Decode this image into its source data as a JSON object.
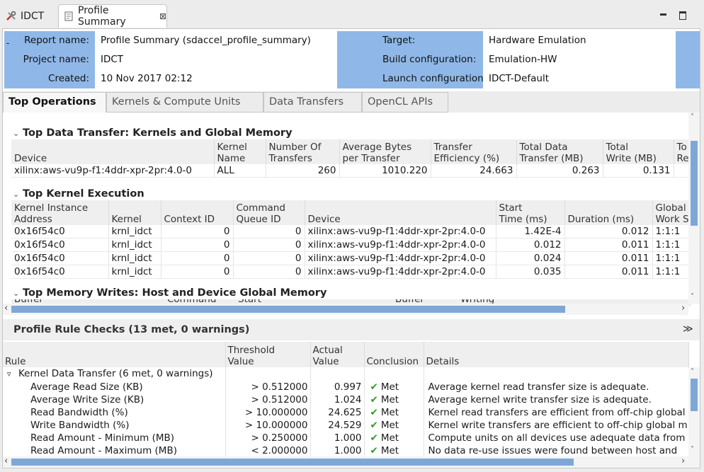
{
  "tabs": {
    "inactive_label": "IDCT",
    "active_label": "Profile Summary",
    "close_glyph": "⊠"
  },
  "header": {
    "report_name_label": "Report name:",
    "report_name": "Profile Summary (sdaccel_profile_summary)",
    "project_name_label": "Project name:",
    "project_name": "IDCT",
    "created_label": "Created:",
    "created": "10 Nov 2017 02:12",
    "target_label": "Target:",
    "target": "Hardware Emulation",
    "build_config_label": "Build configuration:",
    "build_config": "Emulation-HW",
    "launch_config_label": "Launch configuration:",
    "launch_config": "IDCT-Default",
    "collapse_glyph": "-"
  },
  "report_tabs": [
    "Top Operations",
    "Kernels & Compute Units",
    "Data Transfers",
    "OpenCL APIs"
  ],
  "data_transfer": {
    "title": "Top Data Transfer: Kernels and Global Memory",
    "twisty": "⌄",
    "headers": [
      "Device",
      "Kernel\nName",
      "Number Of\nTransfers",
      "Average Bytes\nper Transfer",
      "Transfer\nEfficiency (%)",
      "Total Data\nTransfer (MB)",
      "Total\nWrite (MB)",
      "To\nRe"
    ],
    "rows": [
      [
        "xilinx:aws-vu9p-f1:4ddr-xpr-2pr:4.0-0",
        "ALL",
        "260",
        "1010.220",
        "24.663",
        "0.263",
        "0.131",
        ""
      ]
    ]
  },
  "kernel_exec": {
    "title": "Top Kernel Execution",
    "twisty": "⌄",
    "headers": [
      "Kernel Instance\nAddress",
      "Kernel",
      "Context ID",
      "Command\nQueue ID",
      "Device",
      "Start\nTime (ms)",
      "Duration (ms)",
      "Global\nWork Si"
    ],
    "rows": [
      [
        "0x16f54c0",
        "krnl_idct",
        "0",
        "0",
        "xilinx:aws-vu9p-f1:4ddr-xpr-2pr:4.0-0",
        "1.42E-4",
        "0.012",
        "1:1:1"
      ],
      [
        "0x16f54c0",
        "krnl_idct",
        "0",
        "0",
        "xilinx:aws-vu9p-f1:4ddr-xpr-2pr:4.0-0",
        "0.012",
        "0.011",
        "1:1:1"
      ],
      [
        "0x16f54c0",
        "krnl_idct",
        "0",
        "0",
        "xilinx:aws-vu9p-f1:4ddr-xpr-2pr:4.0-0",
        "0.024",
        "0.011",
        "1:1:1"
      ],
      [
        "0x16f54c0",
        "krnl_idct",
        "0",
        "0",
        "xilinx:aws-vu9p-f1:4ddr-xpr-2pr:4.0-0",
        "0.035",
        "0.011",
        "1:1:1"
      ]
    ]
  },
  "memory_writes": {
    "title": "Top Memory Writes: Host and Device Global Memory",
    "twisty": "⌄",
    "partial_headers": [
      "Buffer",
      "Command",
      "Start",
      "Buffer",
      "Writing"
    ]
  },
  "rules": {
    "title": "Profile Rule Checks (13 met, 0 warnings)",
    "collapse_glyph": "≫",
    "headers": [
      "Rule",
      "Threshold\nValue",
      "Actual\nValue",
      "Conclusion",
      "Details"
    ],
    "group": {
      "twisty": "▿",
      "label": "Kernel Data Transfer (6 met, 0 warnings)"
    },
    "rows": [
      {
        "rule": "Average Read Size (KB)",
        "threshold": "> 0.512000",
        "actual": "0.997",
        "conclusion": "Met",
        "details": "Average kernel read transfer size is adequate."
      },
      {
        "rule": "Average Write Size (KB)",
        "threshold": "> 0.512000",
        "actual": "1.024",
        "conclusion": "Met",
        "details": "Average kernel write transfer size is adequate."
      },
      {
        "rule": "Read Bandwidth (%)",
        "threshold": "> 10.000000",
        "actual": "24.625",
        "conclusion": "Met",
        "details": "Kernel read transfers are efficient from off-chip global"
      },
      {
        "rule": "Write Bandwidth (%)",
        "threshold": "> 10.000000",
        "actual": "24.529",
        "conclusion": "Met",
        "details": "Kernel write transfers are efficient to off-chip global m"
      },
      {
        "rule": "Read Amount - Minimum (MB)",
        "threshold": "> 0.250000",
        "actual": "1.000",
        "conclusion": "Met",
        "details": "Compute units on all devices use adequate data from"
      },
      {
        "rule": "Read Amount - Maximum (MB)",
        "threshold": "< 2.000000",
        "actual": "1.000",
        "conclusion": "Met",
        "details": "No data re-use issues were found between host and"
      }
    ],
    "check_glyph": "✔"
  },
  "scroll": {
    "left_arrow": "‹",
    "right_arrow": "›",
    "up_arrow": "˄",
    "down_arrow": "˅"
  },
  "colors": {
    "header_label_bg": "#8fb8e8",
    "scroll_thumb": "#7fa7d6",
    "met_check": "#2e9a2e"
  }
}
